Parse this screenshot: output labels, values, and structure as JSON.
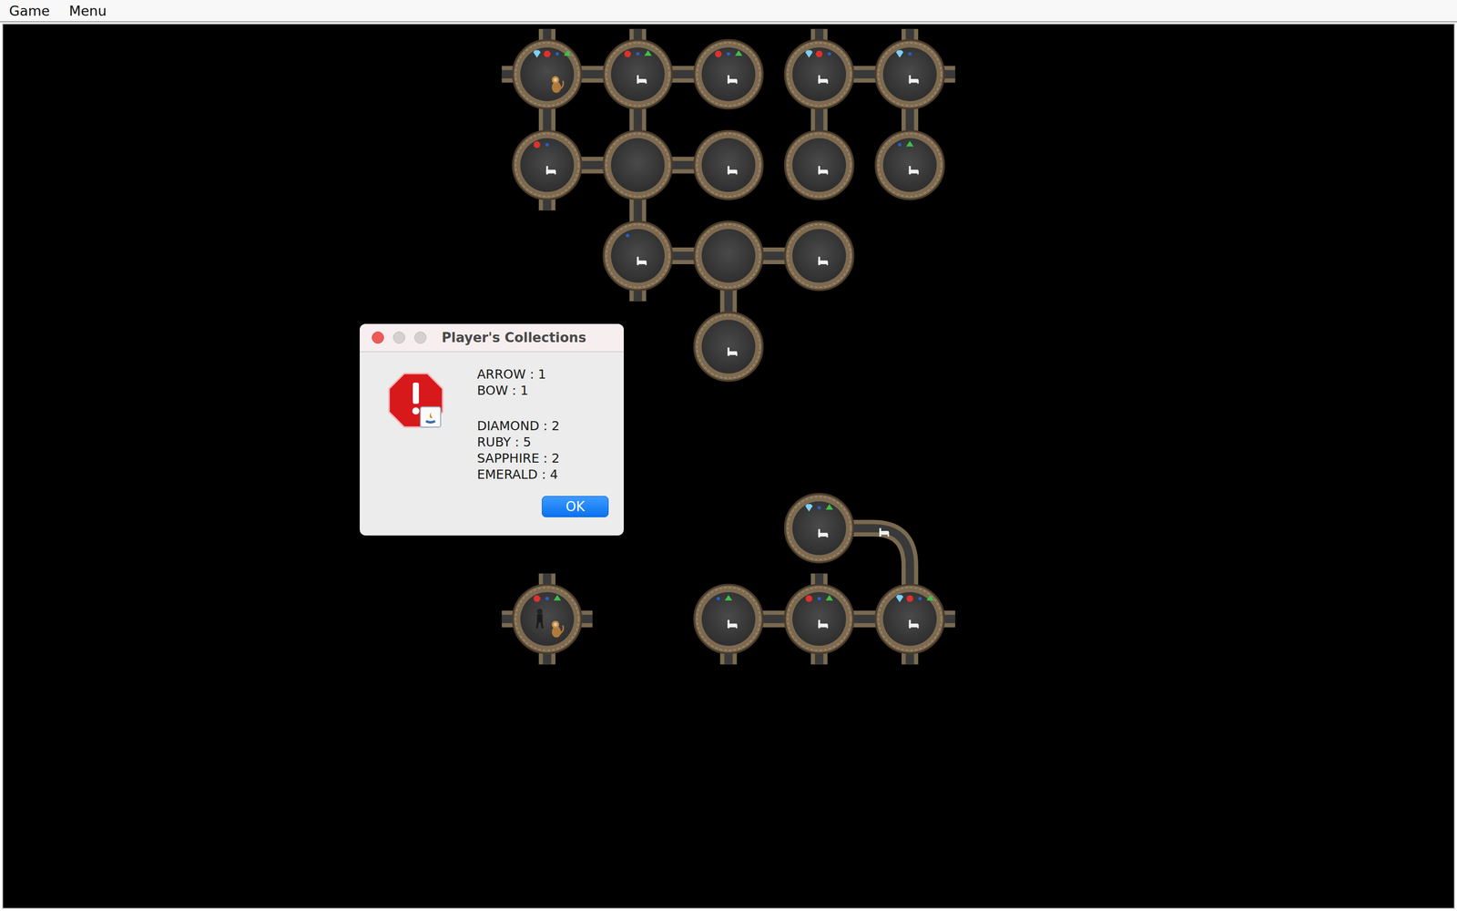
{
  "menu": [
    {
      "label": "Game"
    },
    {
      "label": "Menu"
    }
  ],
  "map": {
    "rooms": [
      {
        "col": 0,
        "row": 0,
        "gems": [
          "diamond",
          "ruby",
          "sapphire",
          "emerald"
        ],
        "bed": false,
        "occupants": [
          "monkey"
        ],
        "exits": [
          "n",
          "w"
        ]
      },
      {
        "col": 1,
        "row": 0,
        "gems": [
          "ruby",
          "sapphire",
          "emerald"
        ],
        "bed": true,
        "occupants": [],
        "exits": [
          "n"
        ]
      },
      {
        "col": 2,
        "row": 0,
        "gems": [
          "ruby",
          "sapphire",
          "emerald"
        ],
        "bed": true,
        "occupants": [],
        "exits": []
      },
      {
        "col": 3,
        "row": 0,
        "gems": [
          "diamond",
          "ruby",
          "sapphire"
        ],
        "bed": true,
        "occupants": [],
        "exits": [
          "n"
        ]
      },
      {
        "col": 4,
        "row": 0,
        "gems": [
          "diamond",
          "sapphire"
        ],
        "bed": true,
        "occupants": [],
        "exits": [
          "n",
          "e"
        ]
      },
      {
        "col": 0,
        "row": 1,
        "gems": [
          "ruby",
          "sapphire"
        ],
        "bed": true,
        "occupants": [],
        "exits": [
          "s"
        ]
      },
      {
        "col": 1,
        "row": 1,
        "gems": [],
        "bed": false,
        "occupants": [],
        "exits": []
      },
      {
        "col": 2,
        "row": 1,
        "gems": [],
        "bed": true,
        "occupants": [],
        "exits": []
      },
      {
        "col": 3,
        "row": 1,
        "gems": [],
        "bed": true,
        "occupants": [],
        "exits": []
      },
      {
        "col": 4,
        "row": 1,
        "gems": [
          "sapphire",
          "emerald"
        ],
        "bed": true,
        "occupants": [],
        "exits": []
      },
      {
        "col": 1,
        "row": 2,
        "gems": [
          "sapphire"
        ],
        "bed": true,
        "occupants": [],
        "exits": [
          "s"
        ]
      },
      {
        "col": 2,
        "row": 2,
        "gems": [],
        "bed": false,
        "occupants": [],
        "exits": []
      },
      {
        "col": 3,
        "row": 2,
        "gems": [],
        "bed": true,
        "occupants": [],
        "exits": []
      },
      {
        "col": 2,
        "row": 3,
        "gems": [],
        "bed": true,
        "occupants": [],
        "exits": []
      },
      {
        "col": 3,
        "row": 5,
        "gems": [
          "diamond",
          "sapphire",
          "emerald"
        ],
        "bed": true,
        "occupants": [],
        "exits": []
      },
      {
        "col": 0,
        "row": 6,
        "gems": [
          "ruby",
          "sapphire",
          "emerald"
        ],
        "bed": false,
        "occupants": [
          "player",
          "monkey"
        ],
        "exits": [
          "n",
          "e",
          "s",
          "w"
        ]
      },
      {
        "col": 2,
        "row": 6,
        "gems": [
          "sapphire",
          "emerald"
        ],
        "bed": true,
        "occupants": [],
        "exits": [
          "s"
        ]
      },
      {
        "col": 3,
        "row": 6,
        "gems": [
          "ruby",
          "sapphire",
          "emerald"
        ],
        "bed": true,
        "occupants": [],
        "exits": [
          "n",
          "s"
        ]
      },
      {
        "col": 4,
        "row": 6,
        "gems": [
          "diamond",
          "ruby",
          "sapphire",
          "emerald"
        ],
        "bed": true,
        "occupants": [],
        "exits": [
          "e",
          "s"
        ]
      }
    ],
    "corridors": [
      {
        "from": 0,
        "to": 1,
        "bed": false
      },
      {
        "from": 1,
        "to": 2,
        "bed": false
      },
      {
        "from": 0,
        "to": 5,
        "bed": false
      },
      {
        "from": 1,
        "to": 6,
        "bed": false
      },
      {
        "from": 3,
        "to": 4,
        "bed": false
      },
      {
        "from": 3,
        "to": 8,
        "bed": false
      },
      {
        "from": 4,
        "to": 9,
        "bed": false
      },
      {
        "from": 5,
        "to": 6,
        "bed": false
      },
      {
        "from": 6,
        "to": 7,
        "bed": false
      },
      {
        "from": 6,
        "to": 10,
        "bed": false
      },
      {
        "from": 10,
        "to": 11,
        "bed": false
      },
      {
        "from": 11,
        "to": 12,
        "bed": false
      },
      {
        "from": 11,
        "to": 13,
        "bed": false
      },
      {
        "from": 16,
        "to": 17,
        "bed": false
      },
      {
        "from": 17,
        "to": 18,
        "bed": false
      },
      {
        "from": 14,
        "to": 18,
        "bed": true
      }
    ]
  },
  "dialog": {
    "title": "Player's Collections",
    "groups": [
      {
        "lines": [
          "ARROW : 1",
          "BOW : 1"
        ]
      },
      {
        "lines": [
          "DIAMOND : 2",
          "RUBY : 5",
          "SAPPHIRE : 2",
          "EMERALD : 4"
        ]
      }
    ],
    "button": "OK"
  }
}
